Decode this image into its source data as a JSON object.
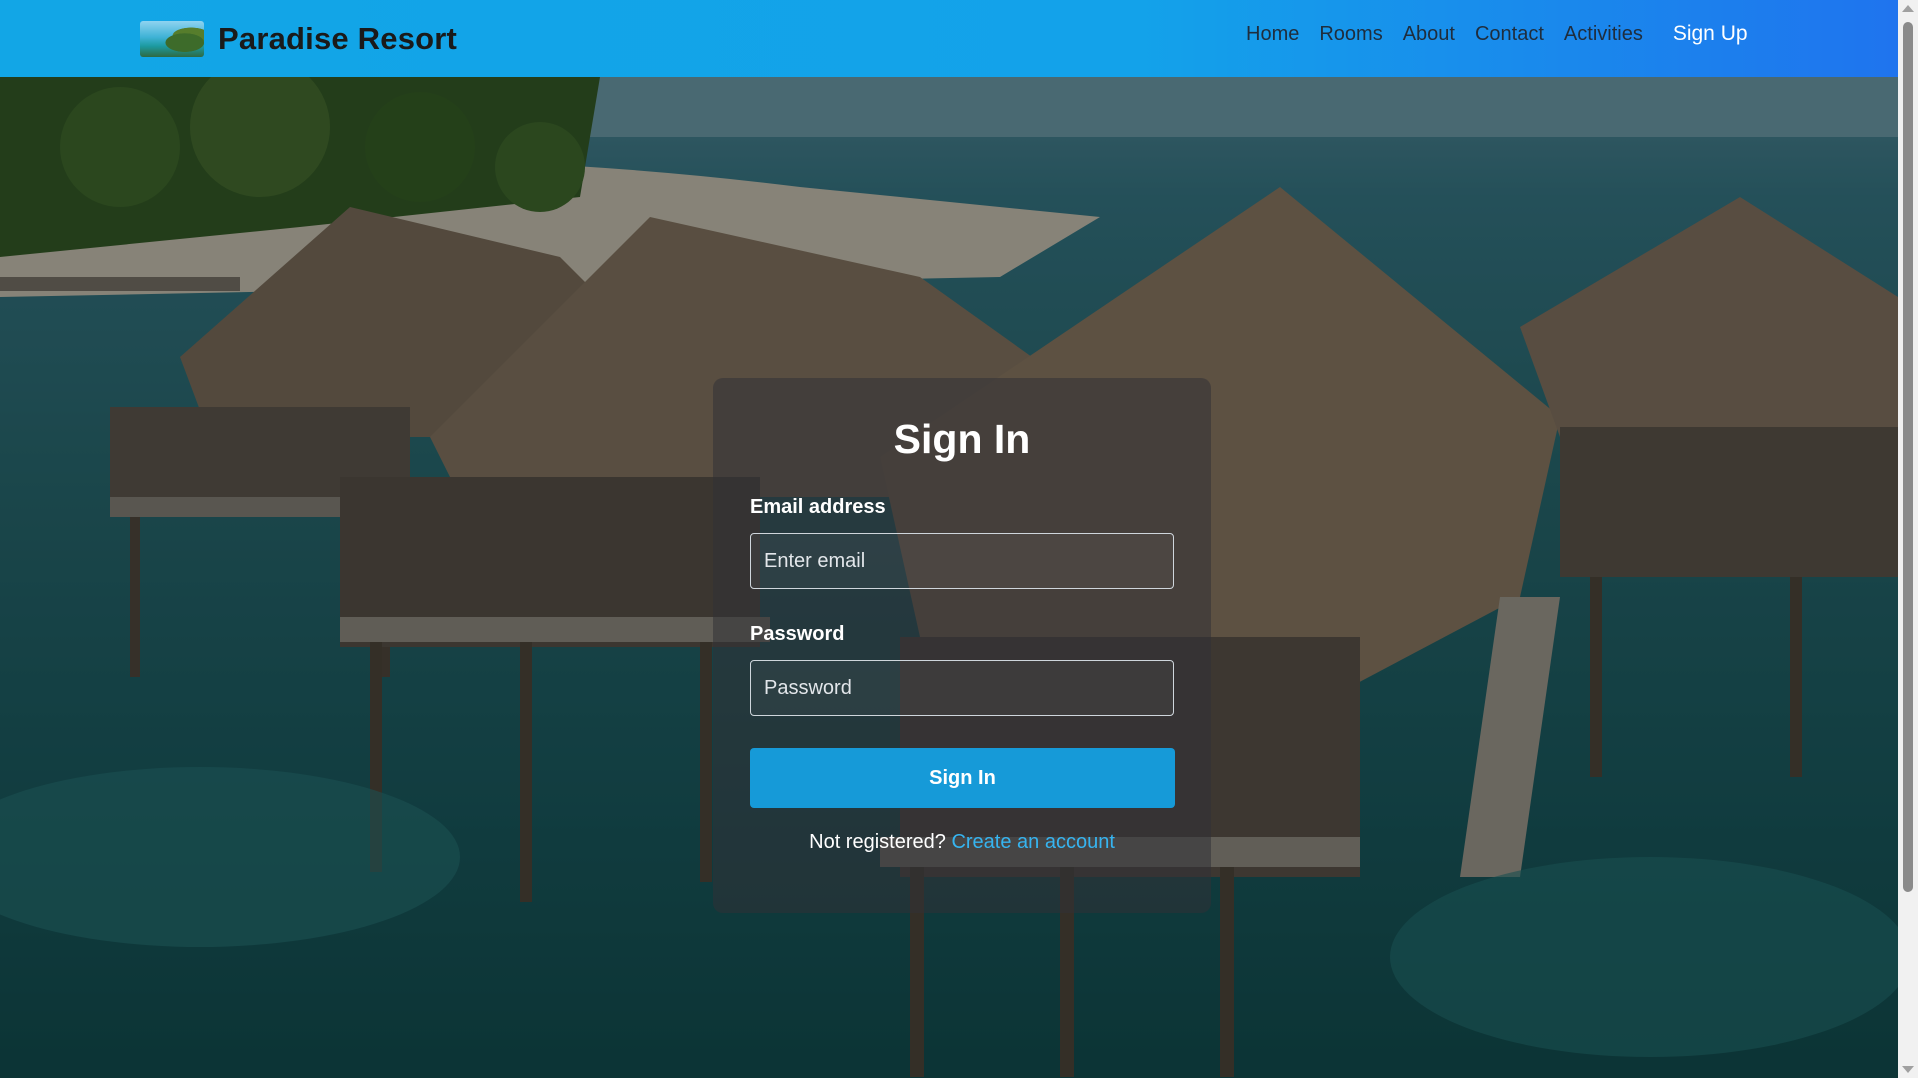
{
  "brand": {
    "name": "Paradise Resort",
    "logo_icon": "resort-island-logo"
  },
  "nav": {
    "links": [
      "Home",
      "Rooms",
      "About",
      "Contact",
      "Activities"
    ],
    "signup_label": "Sign Up"
  },
  "form": {
    "title": "Sign In",
    "email_label": "Email address",
    "email_placeholder": "Enter email",
    "email_value": "",
    "password_label": "Password",
    "password_placeholder": "Password",
    "password_value": "",
    "submit_label": "Sign In",
    "register_prompt": "Not registered?",
    "register_link": "Create an account"
  },
  "colors": {
    "navbar": "#12a6e6",
    "button": "#169ad8",
    "link": "#36b4f0"
  }
}
